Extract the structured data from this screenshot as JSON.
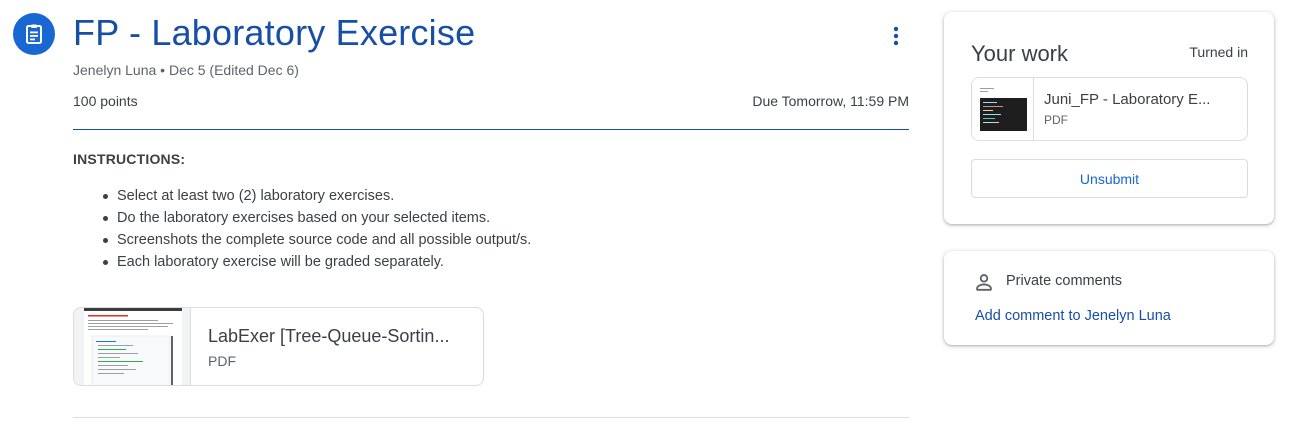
{
  "assignment": {
    "icon": "assignment-icon",
    "title": "FP - Laboratory Exercise",
    "meta": "Jenelyn Luna • Dec 5 (Edited Dec 6)",
    "points": "100 points",
    "due": "Due Tomorrow, 11:59 PM",
    "more_icon": "more-vert-icon"
  },
  "instructions": {
    "heading": "INSTRUCTIONS:",
    "items": [
      "Select at least two (2) laboratory exercises.",
      "Do the laboratory exercises based on your selected items.",
      "Screenshots the complete source code and all possible output/s.",
      "Each laboratory exercise will be graded separately."
    ]
  },
  "attachment": {
    "title": "LabExer [Tree-Queue-Sortin...",
    "type": "PDF"
  },
  "your_work": {
    "title": "Your work",
    "status": "Turned in",
    "file": {
      "title": "Juni_FP - Laboratory E...",
      "type": "PDF"
    },
    "unsubmit_label": "Unsubmit"
  },
  "private_comments": {
    "icon": "person-icon",
    "label": "Private comments",
    "add_link": "Add comment to Jenelyn Luna"
  },
  "colors": {
    "accent": "#1967d2",
    "title_blue": "#174ea6",
    "text": "#3c4043",
    "muted": "#5f6368",
    "border": "#dadce0"
  }
}
